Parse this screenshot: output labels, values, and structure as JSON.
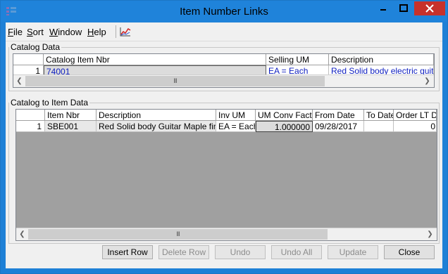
{
  "window": {
    "title": "Item Number Links",
    "minimize_glyph": "–",
    "maximize_glyph": "□",
    "close_glyph": "✕"
  },
  "menu": {
    "items": [
      "File",
      "Sort",
      "Window",
      "Help"
    ],
    "toolbar_icon": "chart-icon"
  },
  "catalog_data": {
    "legend": "Catalog Data",
    "columns": [
      "Catalog Item Nbr",
      "Selling UM",
      "Description"
    ],
    "rows": [
      {
        "num": "1",
        "catalog_item_nbr": "74001",
        "selling_um": "EA  = Each",
        "description": "Red Solid body electric guitar"
      }
    ],
    "scroll_thumb": "III"
  },
  "catalog_to_item": {
    "legend": "Catalog to Item Data",
    "columns": [
      "Item Nbr",
      "Description",
      "Inv UM",
      "UM Conv Factor",
      "From Date",
      "To Date",
      "Order LT Da"
    ],
    "rows": [
      {
        "num": "1",
        "item_nbr": "SBE001",
        "description": "Red Solid body Guitar Maple fingerboard",
        "inv_um": "EA = Each",
        "um_conv_factor": "1.000000",
        "from_date": "09/28/2017",
        "to_date": "",
        "order_lt": "0"
      }
    ],
    "scroll_thumb": "III"
  },
  "buttons": {
    "insert_row": "Insert Row",
    "delete_row": "Delete Row",
    "undo": "Undo",
    "undo_all": "Undo All",
    "update": "Update",
    "close": "Close"
  },
  "colors": {
    "titlebar": "#1f83da",
    "close_button": "#c7312b",
    "link_text": "#1020c0"
  }
}
